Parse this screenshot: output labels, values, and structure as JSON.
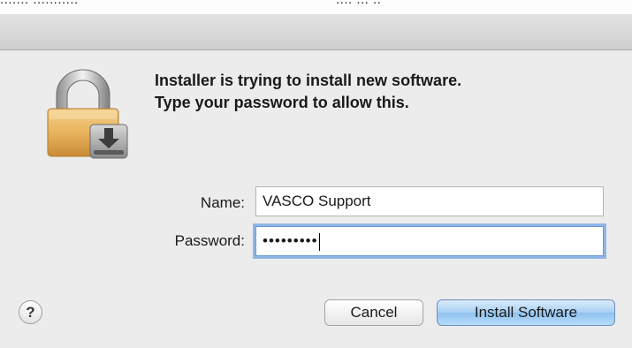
{
  "top_fragment_left": "....... ...........",
  "top_fragment_right": ".... ... ..",
  "dialog": {
    "message_line1": "Installer is trying to install new software.",
    "message_line2": "Type your password to allow this.",
    "name_label": "Name:",
    "name_value": "VASCO Support",
    "password_label": "Password:",
    "password_value": "•••••••••",
    "help_label": "?",
    "cancel_label": "Cancel",
    "install_label": "Install Software"
  },
  "colors": {
    "default_button": "#a8cff2",
    "focus_ring": "#8fb6e6",
    "lock_body": "#e8b45e"
  }
}
